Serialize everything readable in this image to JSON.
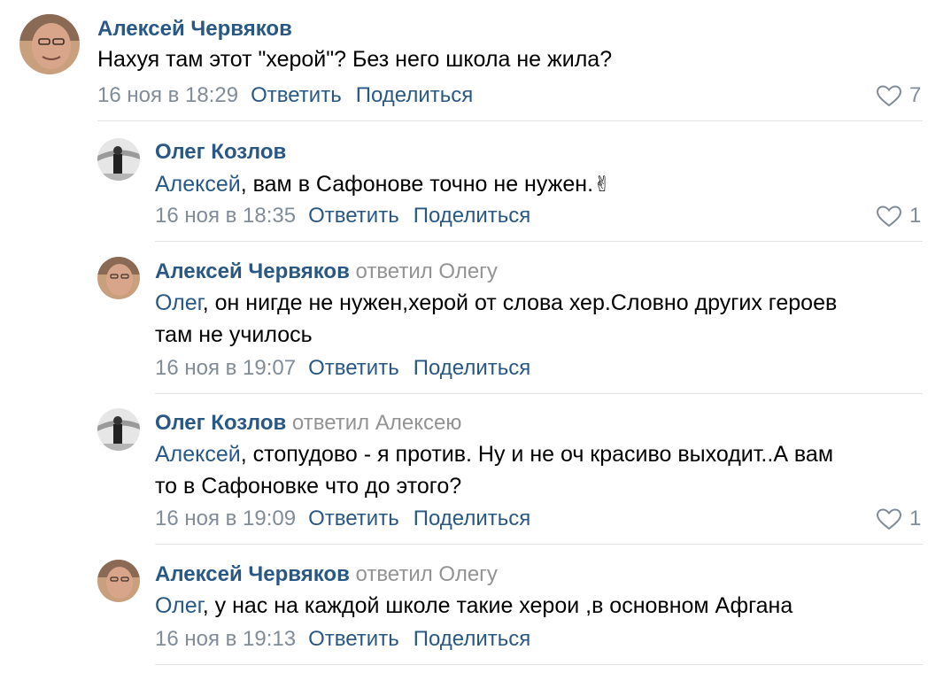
{
  "comments": [
    {
      "author": "Алексей Червяков",
      "replied_to": "",
      "mention": "",
      "text": "Нахуя там этот \"херой\"? Без него школа не жила?",
      "text_line2": "",
      "date": "16 ноя в 18:29",
      "reply_label": "Ответить",
      "share_label": "Поделиться",
      "likes": "7",
      "avatar_icon": "user-avatar-photo"
    },
    {
      "author": "Олег Козлов",
      "replied_to": "",
      "mention": "Алексей",
      "text": ", вам в Сафонове точно не нужен.",
      "emoji": "✌",
      "text_line2": "",
      "date": "16 ноя в 18:35",
      "reply_label": "Ответить",
      "share_label": "Поделиться",
      "likes": "1",
      "avatar_icon": "user-avatar-photo"
    },
    {
      "author": "Алексей Червяков",
      "replied_to": "ответил Олегу",
      "mention": "Олег",
      "text": ", он нигде не нужен,херой от слова хер.Словно других героев",
      "text_line2": "там не училось",
      "date": "16 ноя в 19:07",
      "reply_label": "Ответить",
      "share_label": "Поделиться",
      "likes": "",
      "avatar_icon": "user-avatar-photo"
    },
    {
      "author": "Олег Козлов",
      "replied_to": "ответил Алексею",
      "mention": "Алексей",
      "text": ", стопудово - я против. Ну и не оч красиво выходит..А вам",
      "text_line2": "то в Сафоновке что до этого?",
      "date": "16 ноя в 19:09",
      "reply_label": "Ответить",
      "share_label": "Поделиться",
      "likes": "1",
      "avatar_icon": "user-avatar-photo"
    },
    {
      "author": "Алексей Червяков",
      "replied_to": "ответил Олегу",
      "mention": "Олег",
      "text": ", у нас на каждой школе такие херои ,в основном Афгана",
      "text_line2": "",
      "date": "16 ноя в 19:13",
      "reply_label": "Ответить",
      "share_label": "Поделиться",
      "likes": "",
      "avatar_icon": "user-avatar-photo"
    }
  ],
  "colors": {
    "link": "#2a5885",
    "secondary": "#818c99",
    "divider": "#e1e3e6"
  }
}
